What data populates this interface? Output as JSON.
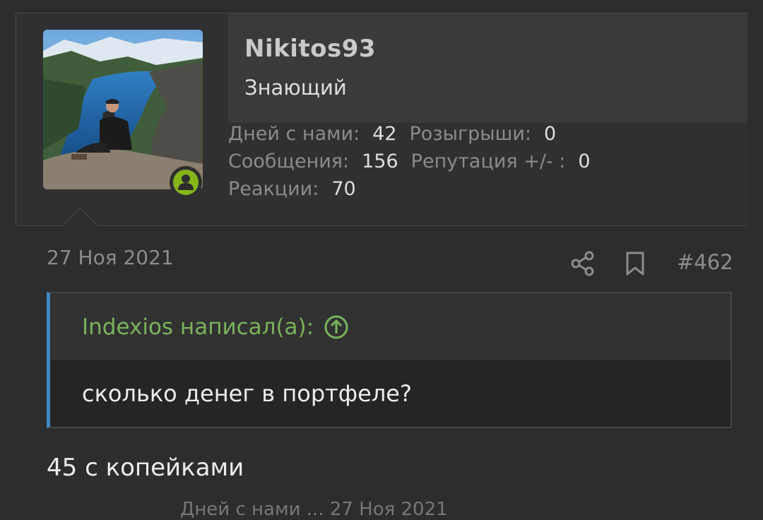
{
  "user": {
    "username": "Nikitos93",
    "title": "Знающий",
    "stats": {
      "days_label": "Дней с нами:",
      "days_value": "42",
      "giveaways_label": "Розыгрыши:",
      "giveaways_value": "0",
      "messages_label": "Сообщения:",
      "messages_value": "156",
      "reputation_label": "Репутация +/- :",
      "reputation_value": "0",
      "reactions_label": "Реакции:",
      "reactions_value": "70"
    },
    "online_status_icon": "user-online-icon",
    "status_color": "#86b51a"
  },
  "post": {
    "date": "27 Ноя 2021",
    "number": "#462",
    "share_icon": "share-icon",
    "bookmark_icon": "bookmark-icon",
    "quote": {
      "author_line": "Indexios написал(а):",
      "text": "сколько денег в портфеле?",
      "accent_color": "#3c88c8",
      "author_color": "#79b35a"
    },
    "text": "45 с копейками"
  },
  "next_post_partial": "Дней с нами ... 27 Ноя 2021"
}
